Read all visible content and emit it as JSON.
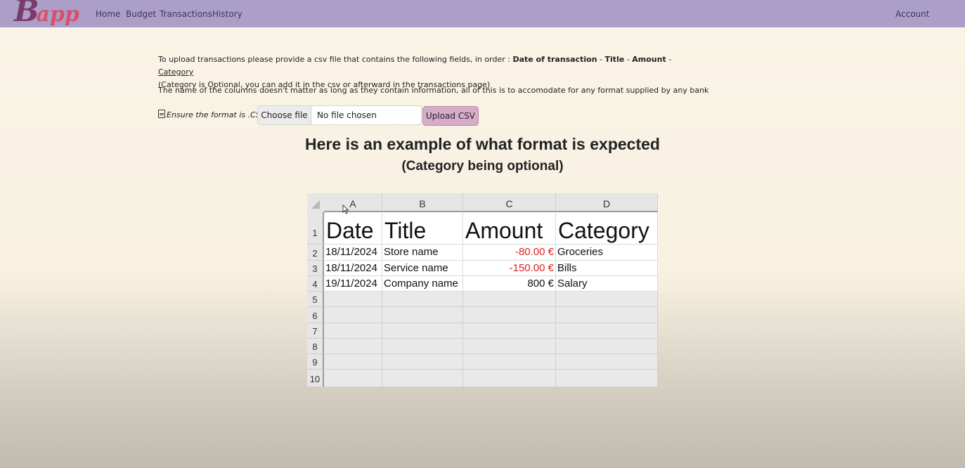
{
  "navbar": {
    "logo_b": "B",
    "logo_rest": "app",
    "links": [
      "Home",
      "Budget",
      "Transactions",
      "History"
    ],
    "account": "Account",
    "bg_color": "#ab9fc9"
  },
  "instructions": {
    "intro": "To upload transactions please provide a csv file that contains the following fields, in order : ",
    "field_date": "Date of transaction",
    "sep": " - ",
    "field_title": "Title",
    "field_amount": "Amount",
    "field_category": "Category",
    "optional_note": "(Category is Optional, you can add it in the csv or afterward in the transactions page)",
    "columns_note": "The name of the columns doesn't matter as long as they contain information, all of this is to accomodate for any format supplied by any bank"
  },
  "upload": {
    "hint": "Ensure the format is .CSV",
    "choose_label": "Choose file",
    "status": "No file chosen",
    "button_label": "Upload CSV",
    "button_color": "#d5adc8"
  },
  "example": {
    "title": "Here is an example of what format is expected",
    "subtitle": "(Category being optional)"
  },
  "sheet": {
    "col_letters": [
      "A",
      "B",
      "C",
      "D"
    ],
    "row_numbers": [
      "1",
      "2",
      "3",
      "4",
      "5",
      "6",
      "7",
      "8",
      "9",
      "10"
    ],
    "header": [
      "Date",
      "Title",
      "Amount",
      "Category"
    ],
    "rows": [
      {
        "date": "18/11/2024",
        "title": "Store name",
        "amount": "-80.00 €",
        "category": "Groceries"
      },
      {
        "date": "18/11/2024",
        "title": "Service name",
        "amount": "-150.00 €",
        "category": "Bills"
      },
      {
        "date": "19/11/2024",
        "title": "Company name",
        "amount": "800 €",
        "category": "Salary"
      }
    ],
    "negative_color": "#e02020"
  }
}
